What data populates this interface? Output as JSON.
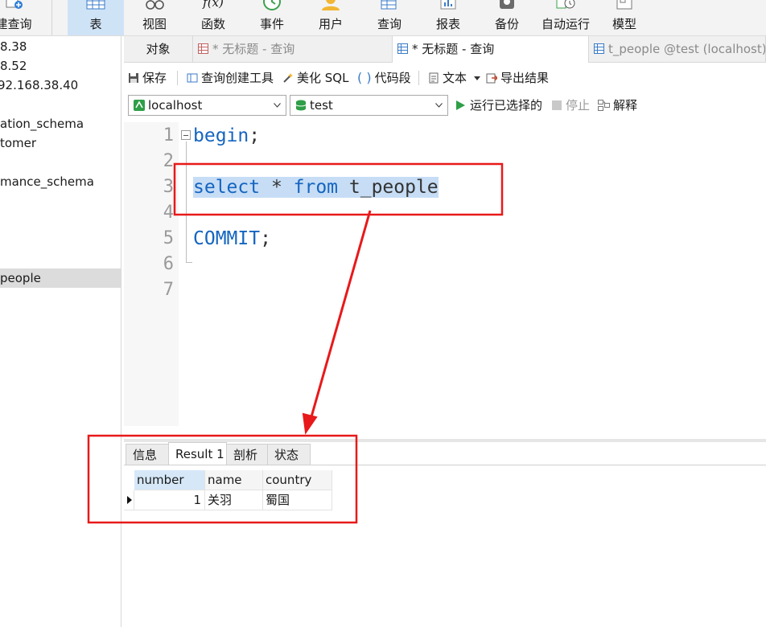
{
  "toolbar": {
    "items": [
      {
        "label": "建查询",
        "icon": "new-query-icon"
      },
      {
        "label": "表",
        "icon": "table-icon"
      },
      {
        "label": "视图",
        "icon": "view-icon"
      },
      {
        "label": "函数",
        "icon": "function-icon"
      },
      {
        "label": "事件",
        "icon": "event-icon"
      },
      {
        "label": "用户",
        "icon": "user-icon"
      },
      {
        "label": "查询",
        "icon": "query-icon"
      },
      {
        "label": "报表",
        "icon": "report-icon"
      },
      {
        "label": "备份",
        "icon": "backup-icon"
      },
      {
        "label": "自动运行",
        "icon": "automation-icon"
      },
      {
        "label": "模型",
        "icon": "model-icon"
      }
    ],
    "function_glyph": "f(x)"
  },
  "nav_tree": {
    "items": [
      {
        "label": "8.38"
      },
      {
        "label": "8.52"
      },
      {
        "label": "92.168.38.40"
      },
      {
        "label": "ation_schema"
      },
      {
        "label": "tomer"
      },
      {
        "label": "mance_schema"
      },
      {
        "label": "people"
      }
    ]
  },
  "tabs": [
    {
      "label": "对象"
    },
    {
      "label": "* 无标题 - 查询"
    },
    {
      "label": "* 无标题 - 查询"
    },
    {
      "label": "t_people @test (localhost)"
    }
  ],
  "query_toolbar": {
    "save": "保存",
    "query_builder": "查询创建工具",
    "beautify": "美化 SQL",
    "snippet": "代码段",
    "text": "文本",
    "export": "导出结果"
  },
  "connection": {
    "server": "localhost",
    "database": "test",
    "run_selected": "运行已选择的",
    "stop": "停止",
    "explain": "解释"
  },
  "editor": {
    "line_numbers": [
      "1",
      "2",
      "3",
      "4",
      "5",
      "6",
      "7"
    ],
    "line1_kw": "begin",
    "line1_rest": ";",
    "line3_select": "select",
    "line3_star": " * ",
    "line3_from": "from",
    "line3_table": " t_people",
    "line5_kw": "COMMIT",
    "line5_rest": ";"
  },
  "result": {
    "tabs": [
      "信息",
      "Result 1",
      "剖析",
      "状态"
    ],
    "columns": [
      "number",
      "name",
      "country"
    ],
    "rows": [
      {
        "number": "1",
        "name": "关羽",
        "country": "蜀国"
      }
    ]
  },
  "colors": {
    "keyword": "#1565c0",
    "selection": "#c6ddf5",
    "annotation": "#e8191a",
    "active_toolbar": "#cfe3f6"
  }
}
